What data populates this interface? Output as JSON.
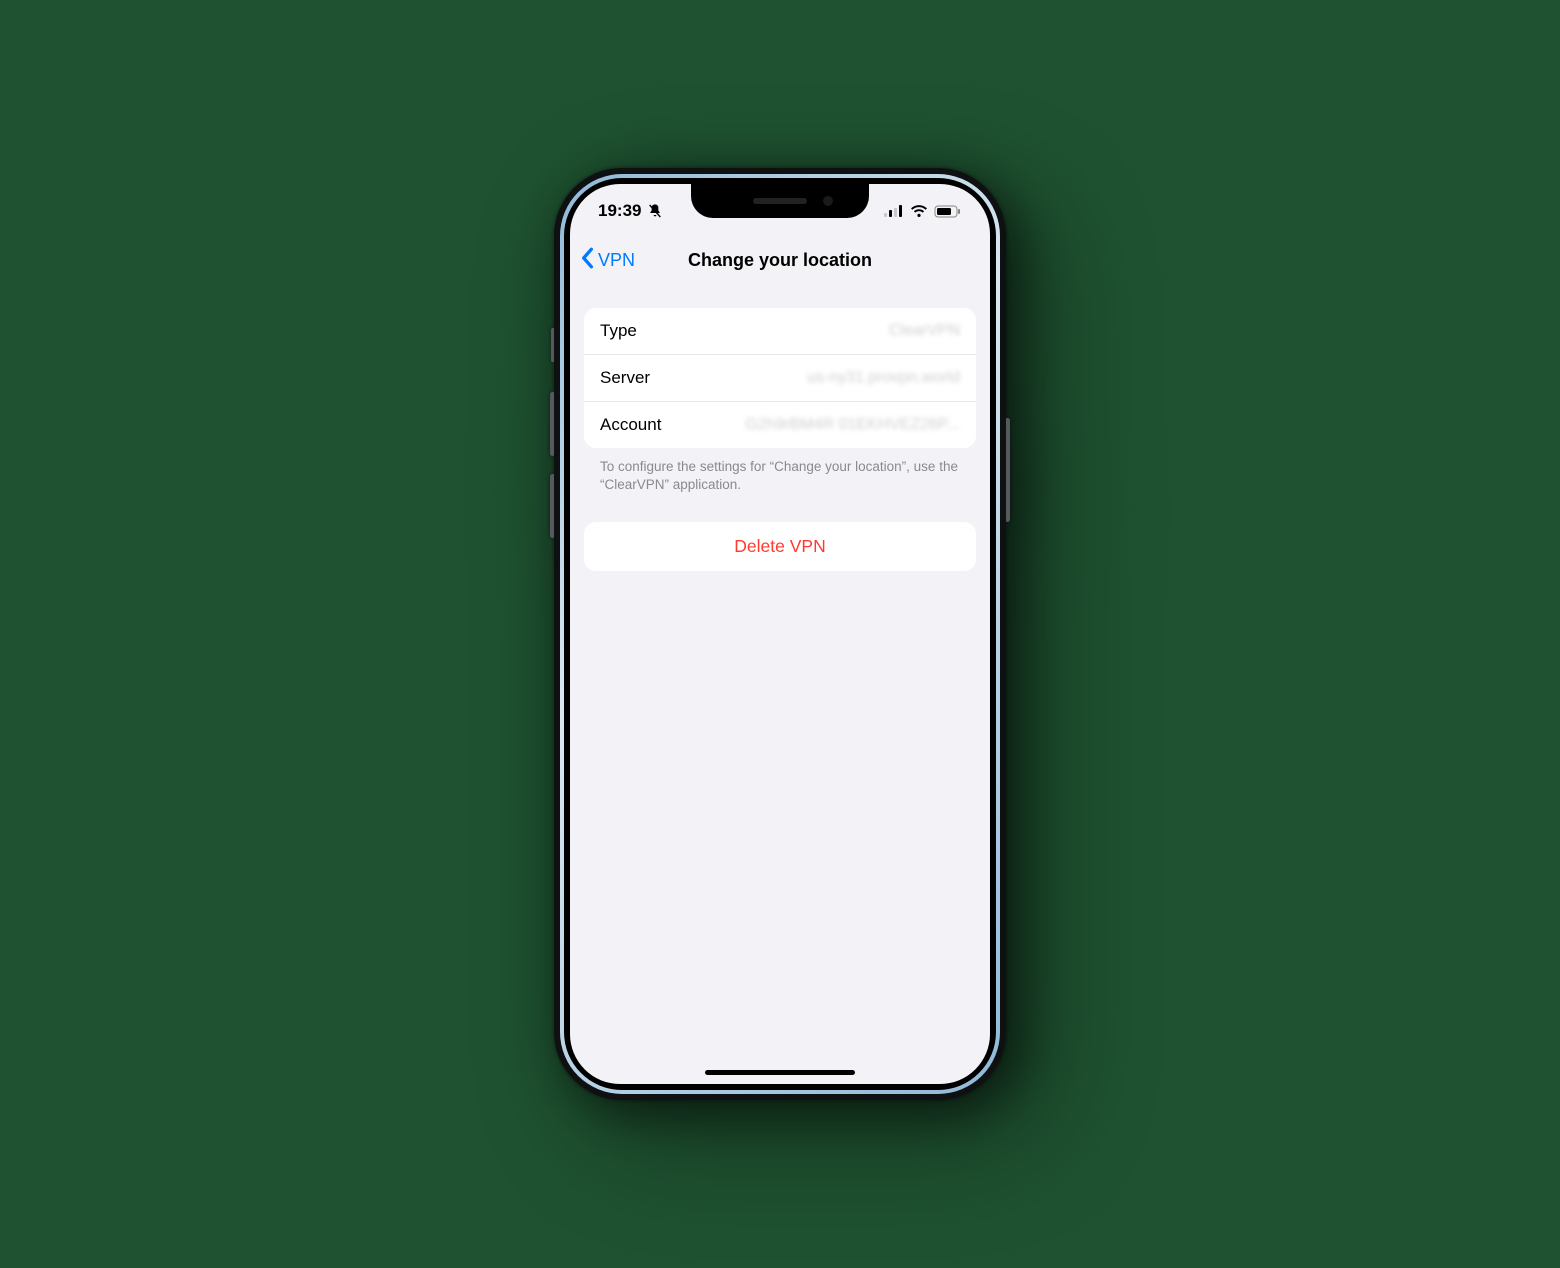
{
  "statusbar": {
    "time": "19:39"
  },
  "nav": {
    "back_label": "VPN",
    "title": "Change your location"
  },
  "details": {
    "rows": [
      {
        "label": "Type",
        "value": "ClearVPN"
      },
      {
        "label": "Server",
        "value": "us-ny31.provpn.world"
      },
      {
        "label": "Account",
        "value": "G2h9rBM4R 01EKHVEZ26P..."
      }
    ],
    "footer": "To configure the settings for “Change your location”, use the “ClearVPN” application."
  },
  "actions": {
    "delete_label": "Delete VPN"
  }
}
